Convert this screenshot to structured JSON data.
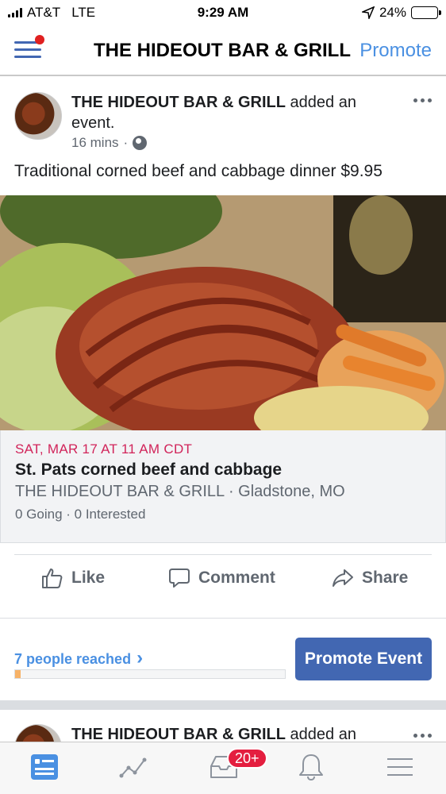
{
  "status_bar": {
    "carrier": "AT&T",
    "network": "LTE",
    "time": "9:29 AM",
    "battery": "24%",
    "battery_level": 0.24
  },
  "nav": {
    "title": "THE HIDEOUT BAR & GRILL",
    "promote_label": "Promote"
  },
  "post": {
    "author": "THE HIDEOUT BAR & GRILL",
    "action_text": " added an event.",
    "time_ago": "16 mins",
    "separator": "·",
    "text": "Traditional corned beef and cabbage dinner $9.95"
  },
  "event": {
    "date": "SAT, MAR 17 AT 11 AM CDT",
    "title": "St. Pats corned beef and cabbage",
    "place": "THE HIDEOUT BAR & GRILL · Gladstone, MO",
    "stats": "0 Going · 0 Interested"
  },
  "actions": {
    "like": "Like",
    "comment": "Comment",
    "share": "Share"
  },
  "promotion": {
    "reached": "7 people reached",
    "chevron": "›",
    "reach_progress": 0.02,
    "button": "Promote Event"
  },
  "next_post": {
    "author": "THE HIDEOUT BAR & GRILL",
    "action_text": " added an"
  },
  "tabbar": {
    "notifications_badge": "20+",
    "accent": "#4267b2"
  },
  "icons": {
    "menu": "hamburger-icon",
    "globe": "globe-icon",
    "more": "more-icon",
    "like": "thumbs-up-icon",
    "comment": "comment-icon",
    "share": "share-icon"
  }
}
